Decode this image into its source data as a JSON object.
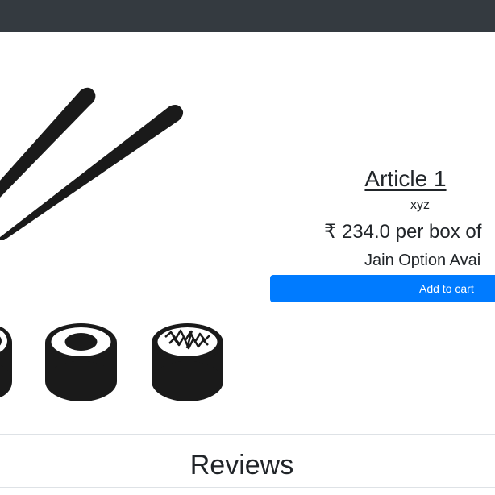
{
  "product": {
    "title": "Article 1",
    "subtitle": "xyz",
    "price": "₹ 234.0 per box of",
    "option": "Jain Option Avai",
    "add_to_cart_label": "Add to cart"
  },
  "reviews": {
    "heading": "Reviews"
  },
  "colors": {
    "navbar": "#343a40",
    "button": "#007bff"
  },
  "image": {
    "icon": "sushi-chopsticks-icon"
  }
}
